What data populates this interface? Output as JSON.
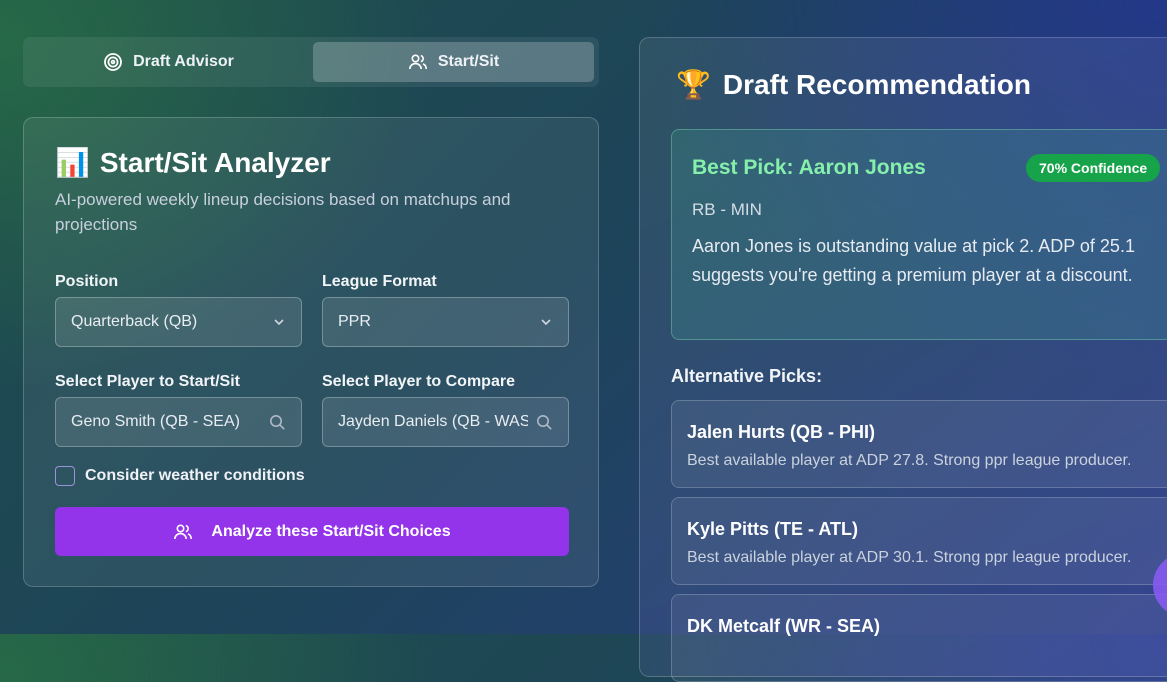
{
  "tabs": [
    {
      "label": "Draft Advisor",
      "icon": "target-icon",
      "active": false
    },
    {
      "label": "Start/Sit",
      "icon": "users-icon",
      "active": true
    }
  ],
  "analyzer": {
    "emoji": "📊",
    "title": "Start/Sit Analyzer",
    "subtitle": "AI-powered weekly lineup decisions based on matchups and projections",
    "position_label": "Position",
    "position_value": "Quarterback (QB)",
    "format_label": "League Format",
    "format_value": "PPR",
    "player_label": "Select Player to Start/Sit",
    "player_value": "Geno Smith (QB - SEA)",
    "compare_label": "Select Player to Compare",
    "compare_value": "Jayden Daniels (QB - WAS)",
    "weather_label": "Consider weather conditions",
    "weather_checked": false,
    "analyze_label": "Analyze these Start/Sit Choices",
    "analyze_color": "#9333ea"
  },
  "recommendation": {
    "emoji": "🏆",
    "title": "Draft Recommendation",
    "best_pick": "Best Pick: Aaron Jones",
    "confidence": "70% Confidence",
    "position": "RB - MIN",
    "description": "Aaron Jones is outstanding value at pick 2. ADP of 25.1 suggests you're getting a premium player at a discount.",
    "alternatives_heading": "Alternative Picks:",
    "alternatives": [
      {
        "name": "Jalen Hurts (QB - PHI)",
        "desc": "Best available player at ADP 27.8. Strong ppr league producer."
      },
      {
        "name": "Kyle Pitts (TE - ATL)",
        "desc": "Best available player at ADP 30.1. Strong ppr league producer."
      },
      {
        "name": "DK Metcalf (WR - SEA)",
        "desc": ""
      }
    ]
  }
}
